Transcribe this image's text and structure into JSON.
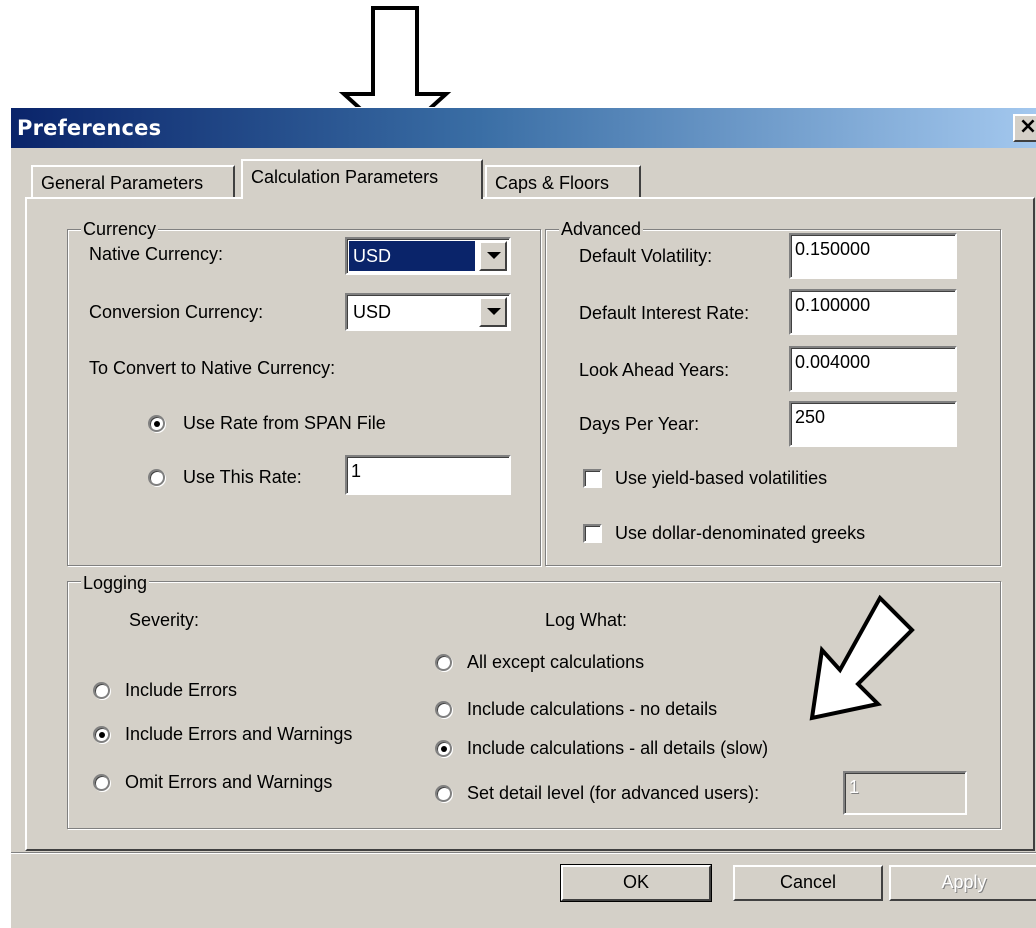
{
  "window": {
    "title": "Preferences",
    "close_glyph": "×"
  },
  "tabs": [
    {
      "label": "General Parameters",
      "active": false
    },
    {
      "label": "Calculation Parameters",
      "active": true
    },
    {
      "label": "Caps & Floors",
      "active": false
    }
  ],
  "currency": {
    "group_label": "Currency",
    "native_label": "Native Currency:",
    "native_value": "USD",
    "conversion_label": "Conversion Currency:",
    "conversion_value": "USD",
    "convert_heading": "To Convert to Native Currency:",
    "option_span": "Use Rate from SPAN File",
    "option_rate": "Use This Rate:",
    "rate_value": "1",
    "selected_option": "span"
  },
  "advanced": {
    "group_label": "Advanced",
    "volatility_label": "Default Volatility:",
    "volatility_value": "0.150000",
    "interest_label": "Default Interest Rate:",
    "interest_value": "0.100000",
    "lookahead_label": "Look Ahead Years:",
    "lookahead_value": "0.004000",
    "days_label": "Days Per Year:",
    "days_value": "250",
    "yield_vol_label": "Use yield-based volatilities",
    "yield_vol_checked": false,
    "dollar_greeks_label": "Use dollar-denominated greeks",
    "dollar_greeks_checked": false
  },
  "logging": {
    "group_label": "Logging",
    "severity_heading": "Severity:",
    "severity_options": [
      "Include Errors",
      "Include Errors and Warnings",
      "Omit Errors and Warnings"
    ],
    "severity_selected": 1,
    "logwhat_heading": "Log What:",
    "logwhat_options": [
      "All except calculations",
      "Include calculations - no details",
      "Include calculations - all details (slow)",
      "Set detail level (for advanced users):"
    ],
    "logwhat_selected": 2,
    "detail_level_value": "1"
  },
  "buttons": {
    "ok": "OK",
    "cancel": "Cancel",
    "apply": "Apply"
  },
  "colors": {
    "face": "#d4d0c8",
    "title_start": "#0a246a",
    "title_end": "#a6caf0",
    "annotation_arrow": "#000000"
  },
  "icons": [
    "close-icon",
    "dropdown-arrow-icon",
    "down-arrow-annotation-icon",
    "diagonal-arrow-annotation-icon"
  ]
}
